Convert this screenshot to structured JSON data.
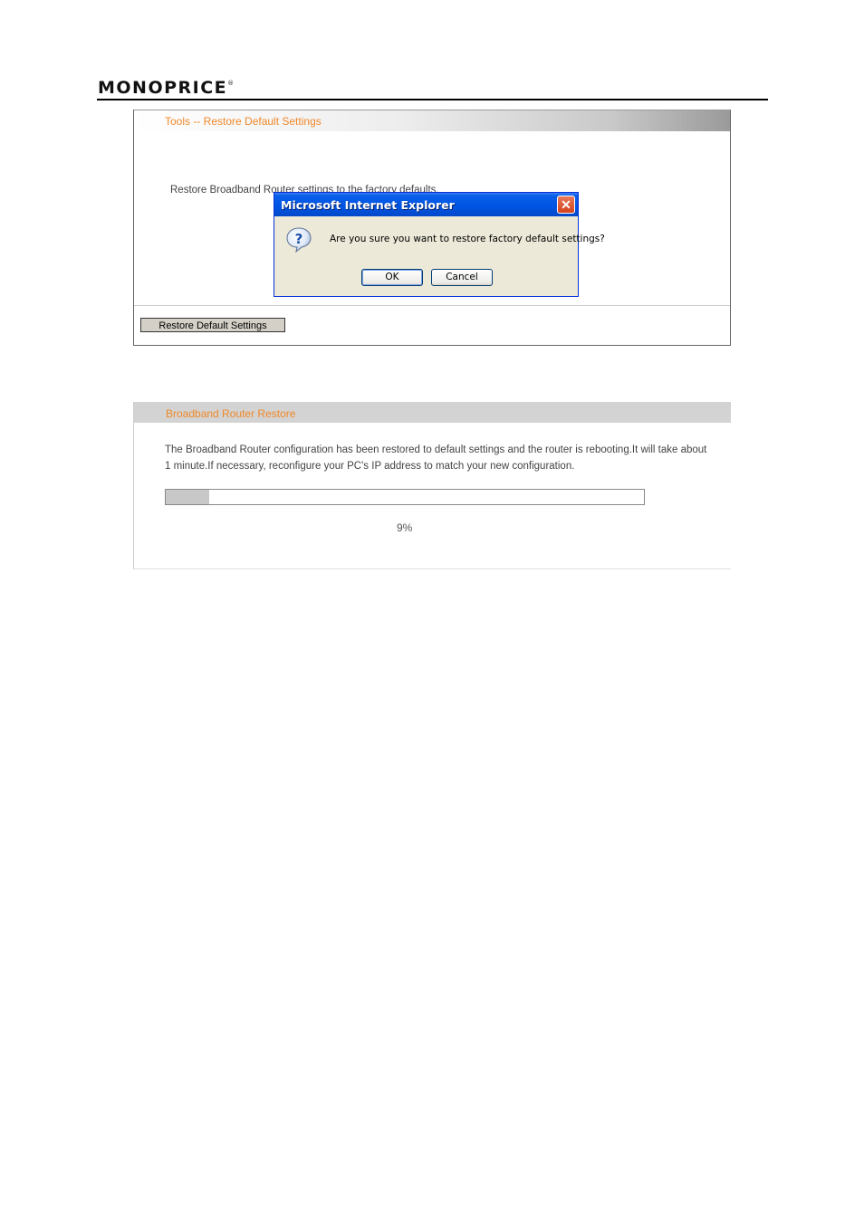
{
  "header": {
    "logo_text": "MONOPRICE",
    "logo_mark": "®"
  },
  "restore_panel": {
    "title": "Tools -- Restore Default Settings",
    "description": "Restore Broadband Router settings to the factory defaults.",
    "button_label": "Restore Default Settings"
  },
  "dialog": {
    "title": "Microsoft Internet Explorer",
    "close_label": "✕",
    "icon": "question-icon",
    "message": "Are you sure you want to restore factory default settings?",
    "ok_label": "OK",
    "cancel_label": "Cancel"
  },
  "reboot_panel": {
    "title": "Broadband Router Restore",
    "message": "The Broadband Router configuration has been restored to default settings and the router is rebooting.It will take about 1 minute.If necessary, reconfigure your PC's IP address to match your new configuration.",
    "progress_percent": 9,
    "progress_label": "9%"
  },
  "colors": {
    "accent": "#f0882a",
    "dialog_title": "#0054e3",
    "progress_fill": "#c8c8c8"
  }
}
